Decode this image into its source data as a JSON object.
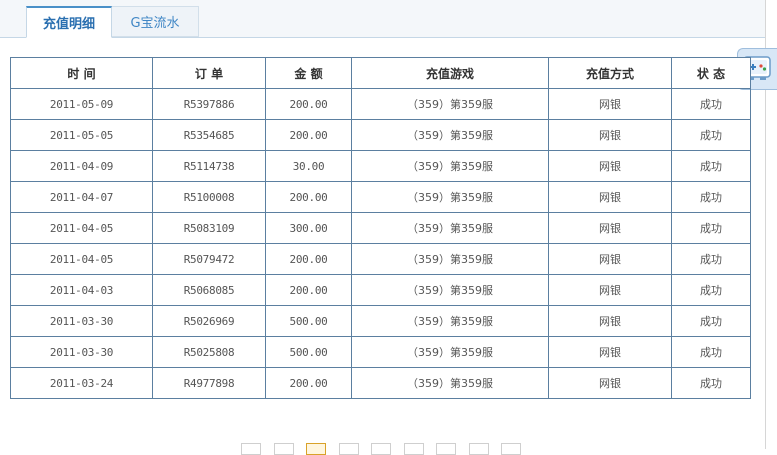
{
  "tabs": [
    {
      "label": "充值明细"
    },
    {
      "label": "G宝流水"
    }
  ],
  "table": {
    "headers": [
      "时 间",
      "订 单",
      "金 额",
      "充值游戏",
      "充值方式",
      "状 态"
    ],
    "rows": [
      [
        "2011-05-09",
        "R5397886",
        "200.00",
        "（359）第359服",
        "网银",
        "成功"
      ],
      [
        "2011-05-05",
        "R5354685",
        "200.00",
        "（359）第359服",
        "网银",
        "成功"
      ],
      [
        "2011-04-09",
        "R5114738",
        "30.00",
        "（359）第359服",
        "网银",
        "成功"
      ],
      [
        "2011-04-07",
        "R5100008",
        "200.00",
        "（359）第359服",
        "网银",
        "成功"
      ],
      [
        "2011-04-05",
        "R5083109",
        "300.00",
        "（359）第359服",
        "网银",
        "成功"
      ],
      [
        "2011-04-05",
        "R5079472",
        "200.00",
        "（359）第359服",
        "网银",
        "成功"
      ],
      [
        "2011-04-03",
        "R5068085",
        "200.00",
        "（359）第359服",
        "网银",
        "成功"
      ],
      [
        "2011-03-30",
        "R5026969",
        "500.00",
        "（359）第359服",
        "网银",
        "成功"
      ],
      [
        "2011-03-30",
        "R5025808",
        "500.00",
        "（359）第359服",
        "网银",
        "成功"
      ],
      [
        "2011-03-24",
        "R4977898",
        "200.00",
        "（359）第359服",
        "网银",
        "成功"
      ]
    ]
  },
  "float_icon": {
    "icon": "gamepad-icon"
  },
  "pager": {
    "page_count": 9,
    "current_index": 2
  },
  "colors": {
    "accent": "#2a6fb0",
    "border": "#5b7fa0",
    "pager_current": "#d9a229"
  }
}
